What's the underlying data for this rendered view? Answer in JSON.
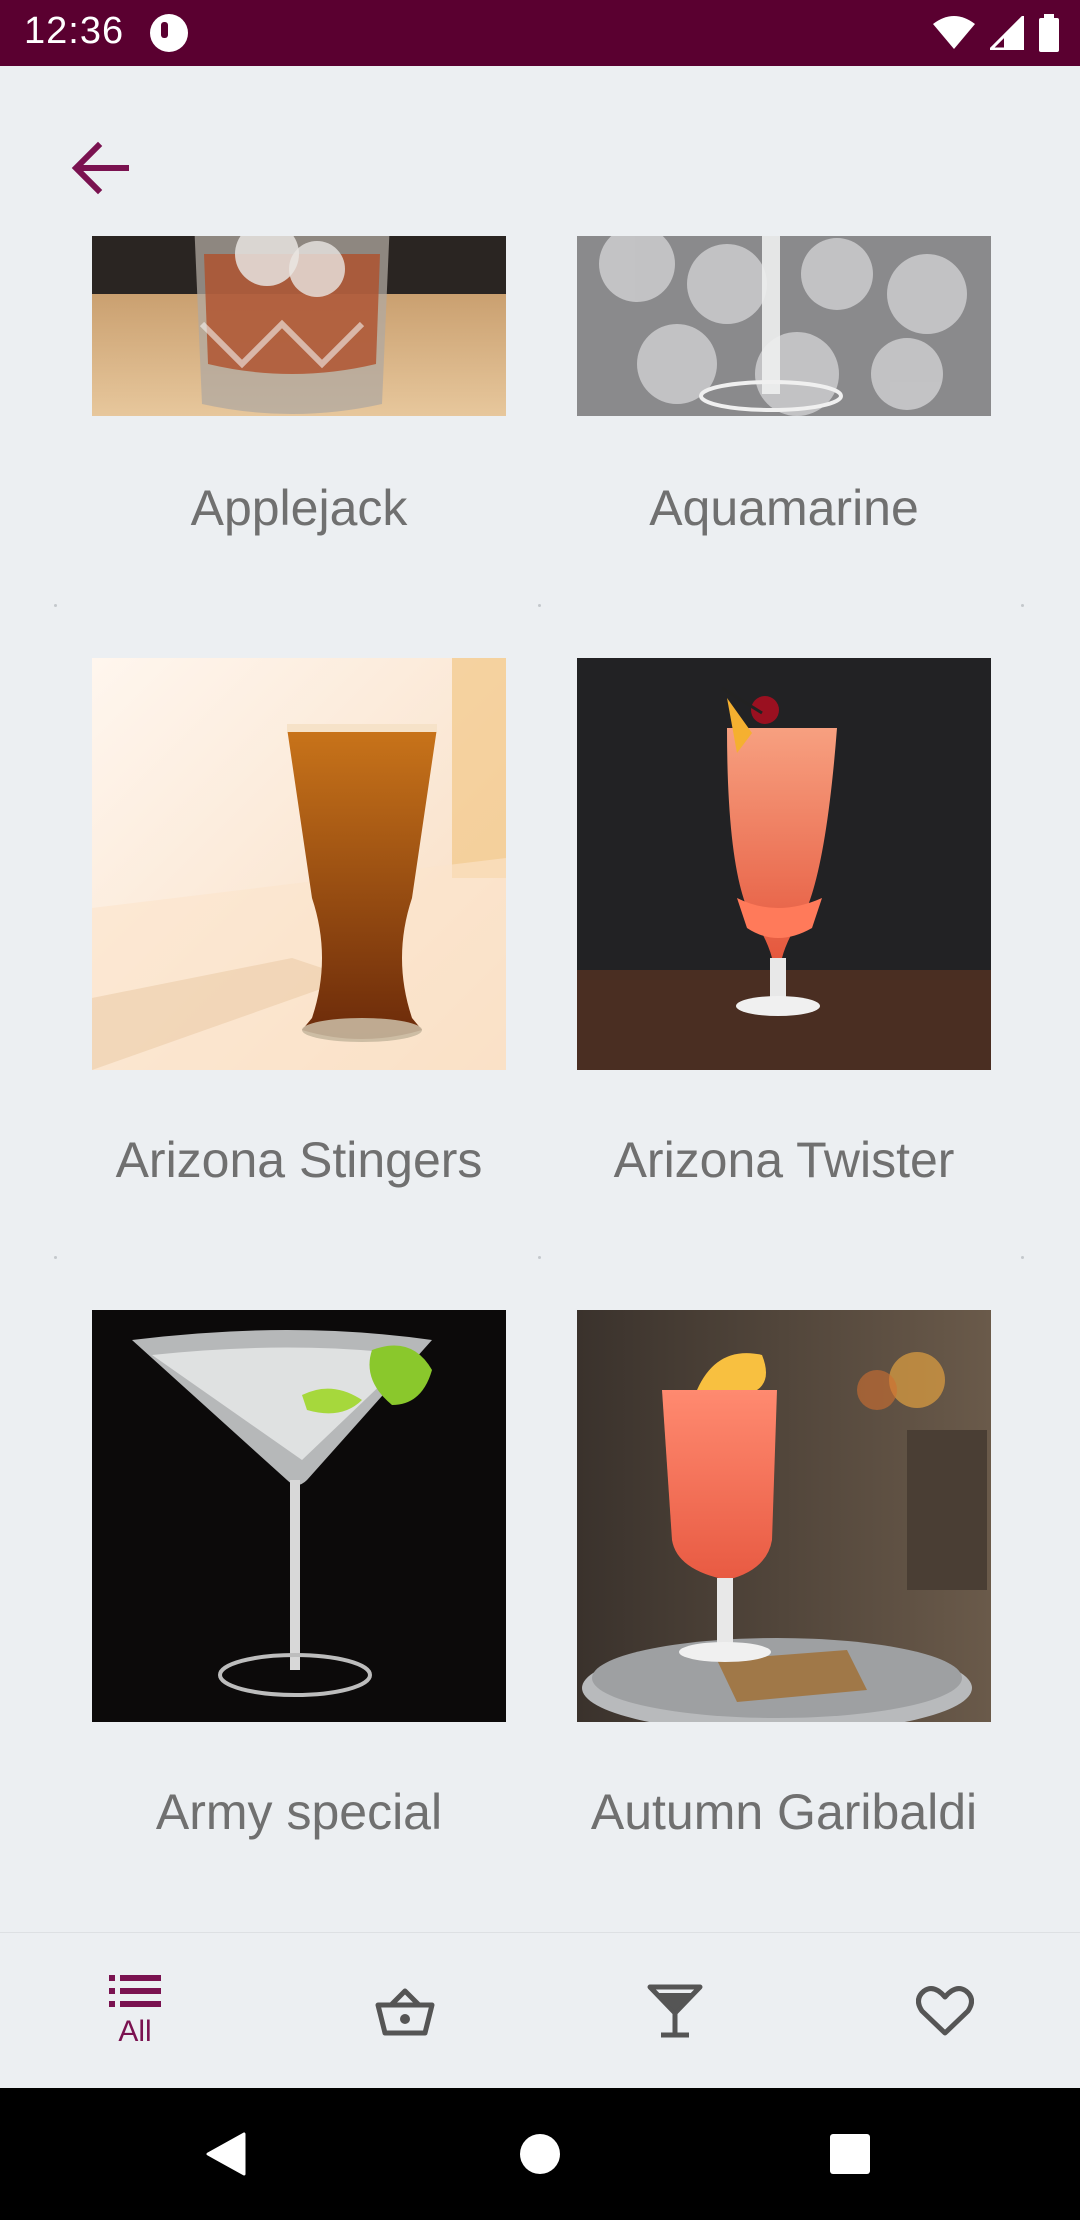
{
  "status_bar": {
    "time": "12:36",
    "icons": [
      "app-notification-icon",
      "wifi-icon",
      "signal-icon",
      "battery-icon"
    ]
  },
  "app_bar": {
    "back_icon": "arrow-left-icon",
    "accent": "#7a1250"
  },
  "drinks": [
    {
      "name": "Applejack",
      "image": "cocktail-photo"
    },
    {
      "name": "Aquamarine",
      "image": "cocktail-photo"
    },
    {
      "name": "Arizona Stingers",
      "image": "cocktail-photo"
    },
    {
      "name": "Arizona Twister",
      "image": "cocktail-photo"
    },
    {
      "name": "Army special",
      "image": "cocktail-photo"
    },
    {
      "name": "Autumn Garibaldi",
      "image": "cocktail-photo"
    }
  ],
  "bottom_nav": {
    "items": [
      {
        "id": "all",
        "label": "All",
        "icon": "list-icon",
        "selected": true
      },
      {
        "id": "basket",
        "label": "",
        "icon": "basket-icon",
        "selected": false
      },
      {
        "id": "cocktail",
        "label": "",
        "icon": "cocktail-glass-icon",
        "selected": false
      },
      {
        "id": "favorites",
        "label": "",
        "icon": "heart-icon",
        "selected": false
      }
    ],
    "selected_color": "#7a1250",
    "unselected_color": "#555555"
  },
  "system_nav": {
    "buttons": [
      "back-triangle-icon",
      "home-circle-icon",
      "recents-square-icon"
    ]
  }
}
